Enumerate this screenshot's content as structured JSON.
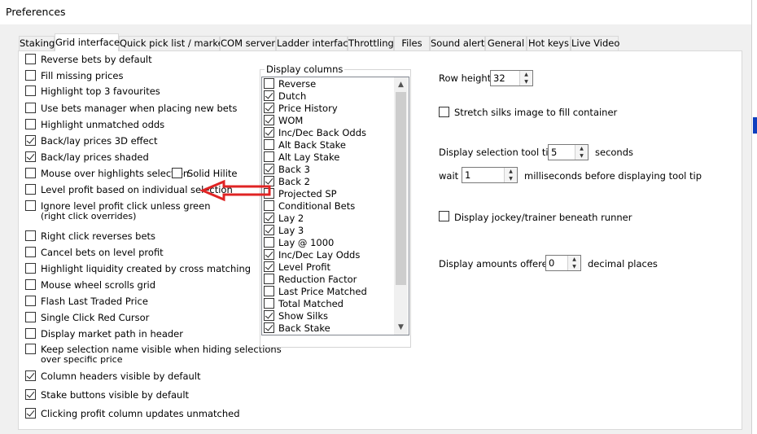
{
  "window": {
    "title": "Preferences"
  },
  "tabs": [
    {
      "label": "Staking"
    },
    {
      "label": "Grid interface"
    },
    {
      "label": "Quick pick list / markets"
    },
    {
      "label": "COM server"
    },
    {
      "label": "Ladder interface"
    },
    {
      "label": "Throttling"
    },
    {
      "label": "Files"
    },
    {
      "label": "Sound alerts"
    },
    {
      "label": "General"
    },
    {
      "label": "Hot keys"
    },
    {
      "label": "Live Video"
    }
  ],
  "active_tab": "Grid interface",
  "options": [
    {
      "label": "Reverse bets by default",
      "checked": false
    },
    {
      "label": "Fill missing prices",
      "checked": false
    },
    {
      "label": "Highlight top 3 favourites",
      "checked": false
    },
    {
      "label": "Use bets manager when placing new bets",
      "checked": false
    },
    {
      "label": "Highlight unmatched odds",
      "checked": false
    },
    {
      "label": "Back/lay prices 3D effect",
      "checked": true
    },
    {
      "label": "Back/lay prices shaded",
      "checked": true
    },
    {
      "label": "Mouse over highlights selection",
      "checked": false
    },
    {
      "label": "Level profit based on individual selection",
      "checked": false
    },
    {
      "label": "Ignore level profit click unless green",
      "label2": "(right click overrides)",
      "checked": false
    },
    {
      "label": "Right click reverses bets",
      "checked": false
    },
    {
      "label": "Cancel bets on level profit",
      "checked": false
    },
    {
      "label": "Highlight liquidity created by cross matching",
      "checked": false
    },
    {
      "label": "Mouse wheel scrolls grid",
      "checked": false
    },
    {
      "label": "Flash Last Traded Price",
      "checked": false
    },
    {
      "label": "Single Click Red Cursor",
      "checked": false
    },
    {
      "label": "Display market path in header",
      "checked": false
    },
    {
      "label": "Keep selection name visible when hiding selections",
      "label2": "over specific price",
      "checked": false
    },
    {
      "label": "Column headers visible by default",
      "checked": true
    },
    {
      "label": "Stake buttons visible by default",
      "checked": true
    },
    {
      "label": "Clicking profit column updates unmatched",
      "checked": true
    }
  ],
  "solid_hilite": {
    "label": "Solid Hilite",
    "checked": false
  },
  "display_columns": {
    "title": "Display columns",
    "items": [
      {
        "label": "Reverse",
        "checked": false
      },
      {
        "label": "Dutch",
        "checked": true
      },
      {
        "label": "Price History",
        "checked": true
      },
      {
        "label": "WOM",
        "checked": true
      },
      {
        "label": "Inc/Dec Back Odds",
        "checked": true
      },
      {
        "label": "Alt Back Stake",
        "checked": false
      },
      {
        "label": "Alt Lay Stake",
        "checked": false
      },
      {
        "label": "Back 3",
        "checked": true
      },
      {
        "label": "Back 2",
        "checked": true
      },
      {
        "label": "Projected SP",
        "checked": false
      },
      {
        "label": "Conditional Bets",
        "checked": false
      },
      {
        "label": "Lay 2",
        "checked": true
      },
      {
        "label": "Lay 3",
        "checked": true
      },
      {
        "label": "Lay @ 1000",
        "checked": false
      },
      {
        "label": "Inc/Dec Lay Odds",
        "checked": true
      },
      {
        "label": "Level Profit",
        "checked": true
      },
      {
        "label": "Reduction Factor",
        "checked": false
      },
      {
        "label": "Last Price Matched",
        "checked": false
      },
      {
        "label": "Total Matched",
        "checked": false
      },
      {
        "label": "Show Silks",
        "checked": true
      },
      {
        "label": "Back Stake",
        "checked": true
      }
    ]
  },
  "right": {
    "row_height_label": "Row height",
    "row_height_value": "32",
    "stretch_silks": {
      "label": "Stretch silks image to fill container",
      "checked": false
    },
    "tooltip_label": "Display selection tool tip for",
    "tooltip_value": "5",
    "tooltip_unit": "seconds",
    "wait_label": "wait",
    "wait_value": "1",
    "wait_unit": "milliseconds before displaying tool tip",
    "jockey": {
      "label": "Display jockey/trainer beneath runner",
      "checked": false
    },
    "amounts_label": "Display amounts offered to",
    "amounts_value": "0",
    "amounts_unit": "decimal places"
  },
  "colors": {
    "annotation_arrow": "#e02424",
    "accent": "#0f3fbf"
  }
}
